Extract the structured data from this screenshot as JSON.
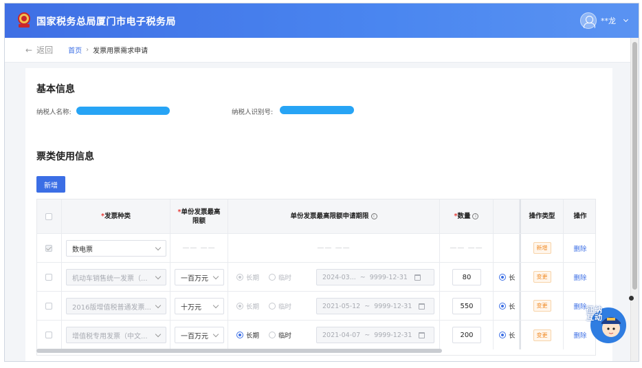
{
  "header": {
    "title": "国家税务总局厦门市电子税务局",
    "user_name": "**龙"
  },
  "breadcrumb": {
    "back_label": "返回",
    "home": "首页",
    "current": "发票用票需求申请"
  },
  "basic_info": {
    "section_title": "基本信息",
    "taxpayer_name_label": "纳税人名称:",
    "taxpayer_id_label": "纳税人识别号:"
  },
  "ticket_info": {
    "section_title": "票类使用信息",
    "add_button": "新增"
  },
  "table": {
    "headers": {
      "invoice_type": "发票种类",
      "max_amount_line1": "单份发票最高",
      "max_amount_line2": "限额",
      "period": "单份发票最高限额申请期限",
      "quantity": "数量",
      "op_type": "操作类型",
      "op": "操作"
    },
    "rows": [
      {
        "invoice_type": "数电票",
        "max_amount": "—— ——",
        "period": "—— ——",
        "quantity": "—— ——",
        "op_type": "新增",
        "op": "删除"
      },
      {
        "invoice_type": "机动车销售统一发票（...",
        "max_amount": "一百万元",
        "radio_long": "长期",
        "radio_temp": "临时",
        "date_start": "2024-03...",
        "date_sep": "~",
        "date_end": "9999-12-31",
        "quantity": "80",
        "trail": "长",
        "op_type": "变更",
        "op": "删除"
      },
      {
        "invoice_type": "2016版增值税普通发票...",
        "max_amount": "十万元",
        "radio_long": "长期",
        "radio_temp": "临时",
        "date_start": "2021-05-12",
        "date_sep": "~",
        "date_end": "9999-12-31",
        "quantity": "550",
        "trail": "长",
        "op_type": "变更",
        "op": "删除"
      },
      {
        "invoice_type": "增值税专用发票（中文...",
        "max_amount": "一百万元",
        "radio_long": "长期",
        "radio_temp": "临时",
        "date_start": "2021-04-07",
        "date_sep": "~",
        "date_end": "9999-12-31",
        "quantity": "200",
        "trail": "长",
        "op_type": "变更",
        "op": "删除"
      }
    ]
  },
  "mascot": {
    "text": "征纳互动"
  },
  "colors": {
    "primary": "#3b6ee5",
    "header_bg": "#4a86f0",
    "redact": "#27a4f5",
    "tag_orange": "#f08a24"
  }
}
